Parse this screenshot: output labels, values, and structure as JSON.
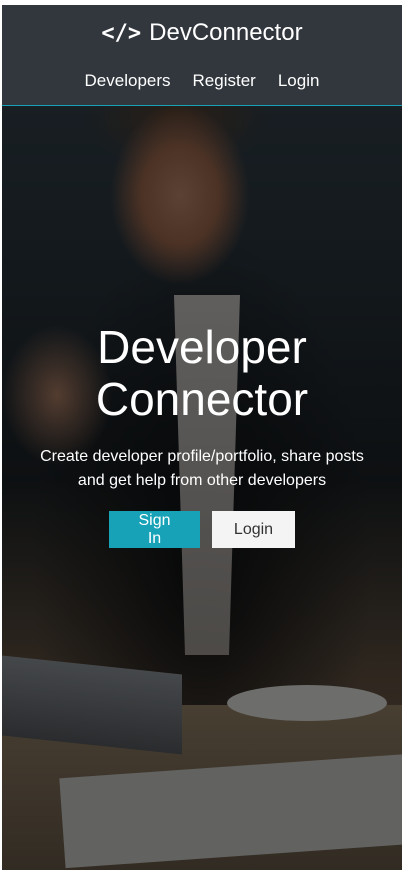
{
  "navbar": {
    "brand_icon": "</>",
    "brand_name": "DevConnector",
    "links": [
      "Developers",
      "Register",
      "Login"
    ]
  },
  "landing": {
    "title_line1": "Developer",
    "title_line2": "Connector",
    "lead": "Create developer profile/portfolio, share posts and get help from other developers",
    "signin_label": "Sign In",
    "login_label": "Login"
  },
  "colors": {
    "primary": "#17a2b8",
    "navbar": "#343a40",
    "light_button": "#f4f4f4"
  }
}
